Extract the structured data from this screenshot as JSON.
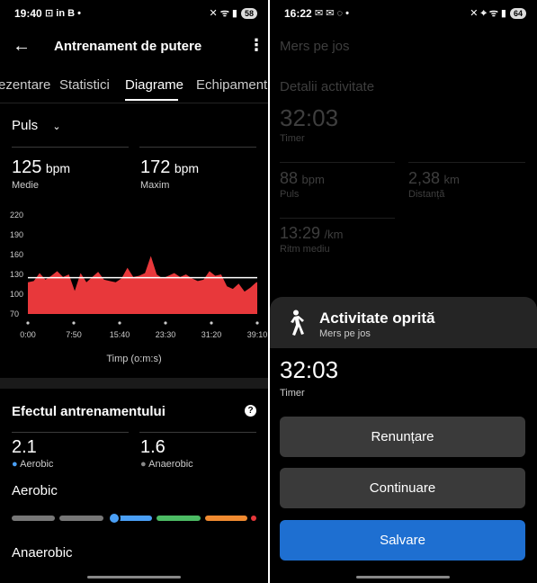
{
  "left": {
    "status": {
      "time": "19:40",
      "icons": "⊡ in B •",
      "right_icons": "✕ ᯤ ▮",
      "battery": "58"
    },
    "title": "Antrenament de putere",
    "tabs": [
      "ezentare",
      "Statistici",
      "Diagrame",
      "Echipament"
    ],
    "metric_selector": "Puls",
    "avg": {
      "value": "125",
      "unit": "bpm",
      "label": "Medie"
    },
    "max": {
      "value": "172",
      "unit": "bpm",
      "label": "Maxim"
    },
    "xaxis_title": "Timp (o:m:s)",
    "effect_title": "Efectul antrenamentului",
    "aerobic": {
      "value": "2.1",
      "label": "Aerobic"
    },
    "anaerobic": {
      "value": "1.6",
      "label": "Anaerobic"
    },
    "aerobic_heading": "Aerobic",
    "anaerobic_heading": "Anaerobic",
    "aerobic_scale_value": 2.1
  },
  "right": {
    "status": {
      "time": "16:22",
      "icons": "✉ ✉ ◌ •",
      "right_icons": "✕ ⌖ ᯤ ▮",
      "battery": "64"
    },
    "bg_title": "Mers pe jos",
    "bg_section": "Detalii activitate",
    "bg_timer": {
      "value": "32:03",
      "label": "Timer"
    },
    "bg_pulse": {
      "value": "88",
      "unit": "bpm",
      "label": "Puls"
    },
    "bg_distance": {
      "value": "2,38",
      "unit": "km",
      "label": "Distanță"
    },
    "bg_pace": {
      "value": "13:29",
      "unit": "/km",
      "label": "Ritm mediu"
    },
    "sheet_title": "Activitate oprită",
    "sheet_subtitle": "Mers pe jos",
    "timer": {
      "value": "32:03",
      "label": "Timer"
    },
    "btn_cancel": "Renunțare",
    "btn_continue": "Continuare",
    "btn_save": "Salvare"
  },
  "chart_data": {
    "type": "area",
    "title": "",
    "xlabel": "Timp (o:m:s)",
    "ylabel": "",
    "x_ticks": [
      "0:00",
      "7:50",
      "15:40",
      "23:30",
      "31:20",
      "39:10"
    ],
    "y_ticks": [
      220,
      190,
      160,
      130,
      100,
      70
    ],
    "ylim": [
      70,
      220
    ],
    "xlim_min": [
      0,
      39.17
    ],
    "average_line": 125,
    "series": [
      {
        "x_min": [
          0,
          1,
          2,
          3,
          4,
          5,
          6,
          7,
          8,
          9,
          10,
          11,
          12,
          13,
          14,
          15,
          16,
          17,
          18,
          19,
          20,
          21,
          22,
          23,
          24,
          25,
          26,
          27,
          28,
          29,
          30,
          31,
          32,
          33,
          34,
          35,
          36,
          37,
          38,
          39
        ],
        "values": [
          118,
          120,
          132,
          122,
          128,
          135,
          126,
          130,
          105,
          132,
          118,
          126,
          134,
          122,
          120,
          118,
          124,
          140,
          126,
          128,
          132,
          158,
          130,
          124,
          128,
          132,
          126,
          130,
          124,
          120,
          122,
          135,
          128,
          130,
          112,
          108,
          116,
          104,
          110,
          118
        ]
      }
    ]
  }
}
